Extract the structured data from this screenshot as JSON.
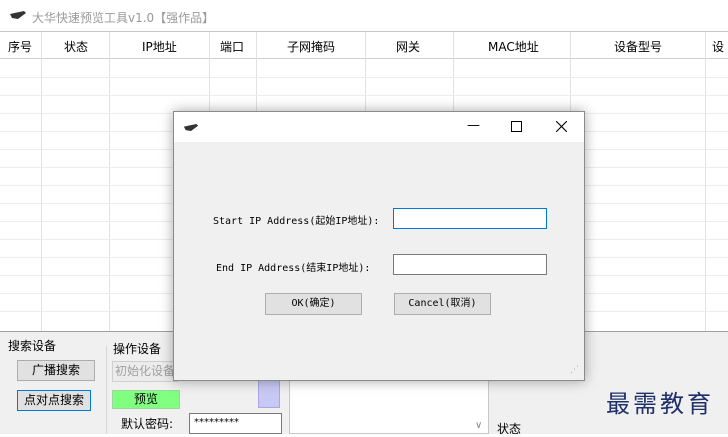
{
  "app": {
    "title": "大华快速预览工具v1.0【强作品】",
    "icon": "bird-logo-icon"
  },
  "table": {
    "columns": [
      "序号",
      "状态",
      "IP地址",
      "端口",
      "子网掩码",
      "网关",
      "MAC地址",
      "设备型号",
      "设"
    ]
  },
  "search_group": {
    "title": "搜索设备",
    "broadcast_label": "广播搜索",
    "p2p_label": "点对点搜索"
  },
  "operate_group": {
    "title": "操作设备",
    "init_label": "初始化设备",
    "preview_label": "预览",
    "default_pwd_label": "默认密码:",
    "default_pwd_value": "*********"
  },
  "status_label": "状态",
  "dialog": {
    "icon": "bird-logo-icon",
    "start_label": "Start IP Address(起始IP地址):",
    "start_value": "",
    "end_label": "End IP Address(结束IP地址):",
    "end_value": "",
    "ok_label": "OK(确定)",
    "cancel_label": "Cancel(取消)"
  },
  "watermark": "最需教育",
  "colors": {
    "preview_green": "#80ff80",
    "focus_blue": "#0078d7",
    "watermark": "#1e2f6a"
  }
}
